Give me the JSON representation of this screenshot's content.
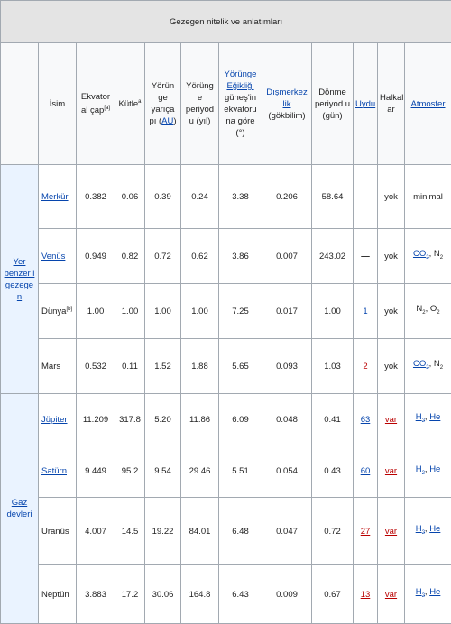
{
  "caption": "Gezegen nitelik ve anlatımları",
  "headers": {
    "isim": "İsim",
    "ekvator": "Ekvator al çap",
    "ekvator_note": "[a]",
    "kutle": "Kütle",
    "kutle_note": "a",
    "yorunge_yaricap_pre": "Yörün ge yarıça pı (",
    "yorunge_yaricap_link": "AU",
    "yorunge_yaricap_post": ")",
    "yorunge_periyod": "Yörüng e periyod u (yıl)",
    "egiklik_link": "Yörünge Eğikliği",
    "egiklik_rest": "güneş'in ekvatoru na göre (°)",
    "dismerkezlik_link": "Dışmerkez lik",
    "dismerkezlik_rest": "(gökbilim)",
    "donme": "Dönme periyod u (gün)",
    "uydu_link": "Uydu",
    "halkalar": "Halkal ar",
    "atmosfer_link": "Atmosfer"
  },
  "groups": {
    "terrestrial": "Yer benzer i gezege n",
    "gas": "Gaz devleri"
  },
  "planets": [
    {
      "name": "Merkür",
      "link": true,
      "diameter": "0.382",
      "mass": "0.06",
      "radius": "0.39",
      "period": "0.24",
      "incl": "3.38",
      "ecc": "0.206",
      "rot": "58.64",
      "moons": "—",
      "rings": "yok",
      "atm": "minimal"
    },
    {
      "name": "Venüs",
      "link": true,
      "diameter": "0.949",
      "mass": "0.82",
      "radius": "0.72",
      "period": "0.62",
      "incl": "3.86",
      "ecc": "0.007",
      "rot": "243.02",
      "moons": "—",
      "rings": "yok",
      "atm_a": "CO",
      "atm_a_sub": "2",
      "atm_b": "N",
      "atm_b_sub": "2"
    },
    {
      "name": "Dünya",
      "note": "[b]",
      "link": false,
      "diameter": "1.00",
      "mass": "1.00",
      "radius": "1.00",
      "period": "1.00",
      "incl": "7.25",
      "ecc": "0.017",
      "rot": "1.00",
      "moons": "1",
      "rings": "yok",
      "atm_a": "N",
      "atm_a_sub": "2",
      "atm_b": "O",
      "atm_b_sub": "2"
    },
    {
      "name": "Mars",
      "link": false,
      "diameter": "0.532",
      "mass": "0.11",
      "radius": "1.52",
      "period": "1.88",
      "incl": "5.65",
      "ecc": "0.093",
      "rot": "1.03",
      "moons": "2",
      "rings": "yok",
      "atm_a": "CO",
      "atm_a_sub": "2",
      "atm_b": "N",
      "atm_b_sub": "2"
    },
    {
      "name": "Jüpiter",
      "link": true,
      "diameter": "11.209",
      "mass": "317.8",
      "radius": "5.20",
      "period": "11.86",
      "incl": "6.09",
      "ecc": "0.048",
      "rot": "0.41",
      "moons": "63",
      "rings": "var",
      "atm_a": "H",
      "atm_a_sub": "2",
      "atm_b": "He",
      "atm_b_sub": ""
    },
    {
      "name": "Satürn",
      "link": true,
      "diameter": "9.449",
      "mass": "95.2",
      "radius": "9.54",
      "period": "29.46",
      "incl": "5.51",
      "ecc": "0.054",
      "rot": "0.43",
      "moons": "60",
      "rings": "var",
      "atm_a": "H",
      "atm_a_sub": "2",
      "atm_b": "He",
      "atm_b_sub": ""
    },
    {
      "name": "Uranüs",
      "link": false,
      "diameter": "4.007",
      "mass": "14.5",
      "radius": "19.22",
      "period": "84.01",
      "incl": "6.48",
      "ecc": "0.047",
      "rot": "0.72",
      "moons": "27",
      "rings": "var",
      "atm_a": "H",
      "atm_a_sub": "2",
      "atm_b": "He",
      "atm_b_sub": ""
    },
    {
      "name": "Neptün",
      "link": false,
      "diameter": "3.883",
      "mass": "17.2",
      "radius": "30.06",
      "period": "164.8",
      "incl": "6.43",
      "ecc": "0.009",
      "rot": "0.67",
      "moons": "13",
      "rings": "var",
      "atm_a": "H",
      "atm_a_sub": "2",
      "atm_b": "He",
      "atm_b_sub": ""
    }
  ],
  "colors": {
    "link": "#0645ad",
    "redlink": "#ba0000",
    "caption_bg": "#e4e4e4",
    "group_bg": "#eaf3ff",
    "border": "#a2a9b1"
  }
}
